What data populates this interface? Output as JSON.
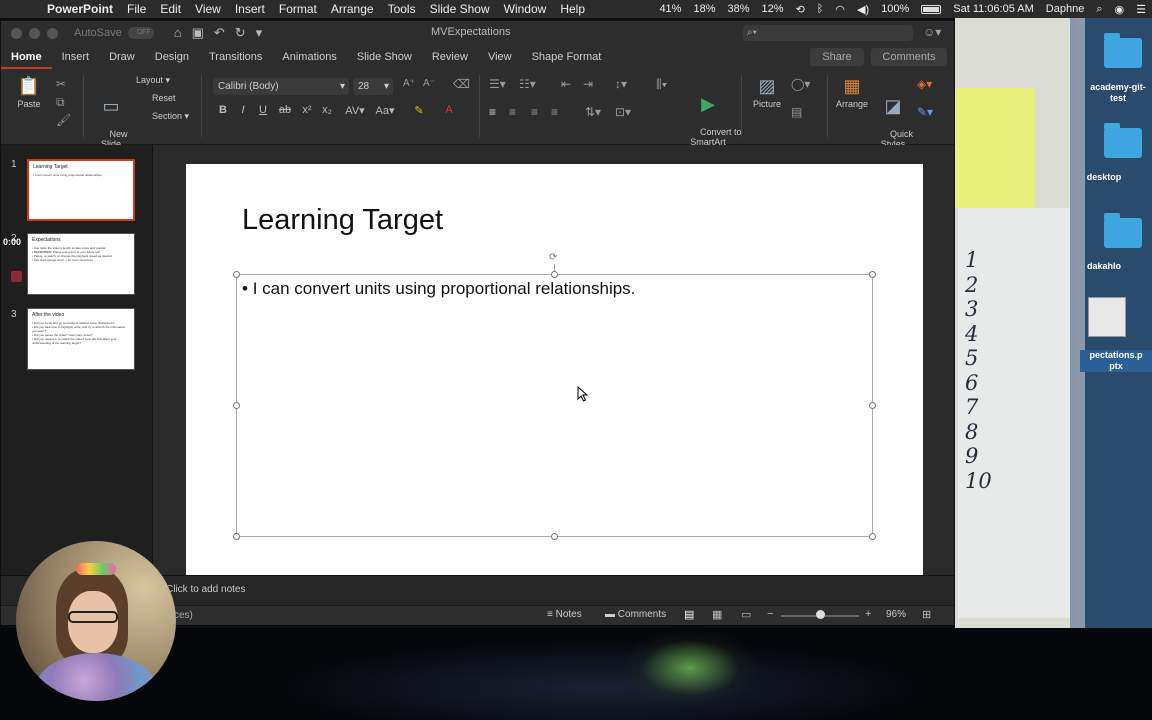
{
  "menubar": {
    "app": "PowerPoint",
    "items": [
      "File",
      "Edit",
      "View",
      "Insert",
      "Format",
      "Arrange",
      "Tools",
      "Slide Show",
      "Window",
      "Help"
    ],
    "status": [
      "41%",
      "18%",
      "38%",
      "12%"
    ],
    "battery": "100%",
    "clock": "Sat 11:06:05 AM",
    "user": "Daphne"
  },
  "window": {
    "autosave_label": "AutoSave",
    "autosave_state": "OFF",
    "doc_title": "MVExpectations"
  },
  "ribbon": {
    "tabs": [
      "Home",
      "Insert",
      "Draw",
      "Design",
      "Transitions",
      "Animations",
      "Slide Show",
      "Review",
      "View",
      "Shape Format"
    ],
    "active_tab": "Home",
    "share": "Share",
    "comments": "Comments",
    "paste": "Paste",
    "new_slide": "New\nSlide",
    "layout": "Layout",
    "reset": "Reset",
    "section": "Section",
    "font_name": "Calibri (Body)",
    "font_size": "28",
    "convert_smartart": "Convert to\nSmartArt",
    "picture": "Picture",
    "arrange": "Arrange",
    "quick_styles": "Quick\nStyles"
  },
  "thumbnails": [
    {
      "num": "1",
      "title": "Learning Target",
      "lines": [
        "• I can convert units using proportional relationships."
      ]
    },
    {
      "num": "2",
      "title": "Expectations",
      "lines": [
        "• Use twice the video's length to take notes and wonder",
        "• REMEMBER: Pause and return to your future self",
        "• Pause, re-watch, or change the playback speed as desired",
        "• Use docs.google.com/.../ for more resources"
      ]
    },
    {
      "num": "3",
      "title": "After the video",
      "lines": [
        "• Did you focus and go somewhere without many distractions?",
        "• Did you take time to highlight, write, and try to absorb the information you learn?",
        "• Did you pause the video? How many times?",
        "• Did you rewind or re-watch the video? How did that affect your understanding of the learning target?"
      ]
    }
  ],
  "recording": {
    "time": "0:00"
  },
  "slide": {
    "title": "Learning Target",
    "bullet": "I can convert units using proportional relationships."
  },
  "notes": {
    "placeholder": "Click to add notes"
  },
  "status": {
    "left": "ces)",
    "notes": "Notes",
    "comments": "Comments",
    "zoom": "96%",
    "zoom_fraction": 0.5
  },
  "desktop": {
    "folder_labels": [
      "academy-git-\ntest",
      "desktop",
      "dakahlo"
    ],
    "file_label": "pectations.p\nptx"
  },
  "notebook_numbers": [
    "1",
    "2",
    "3",
    "4",
    "5",
    "6",
    "7",
    "8",
    "9",
    "10"
  ]
}
